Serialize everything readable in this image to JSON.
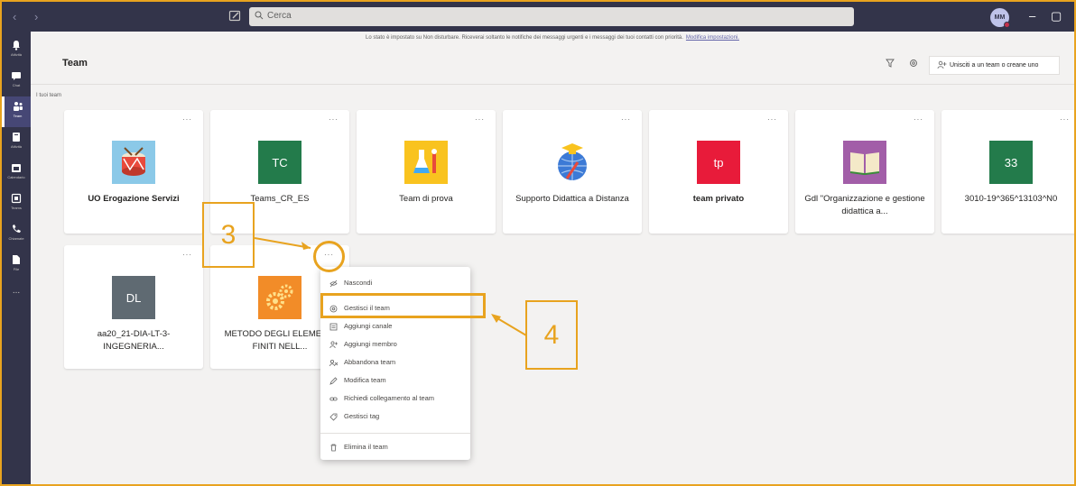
{
  "titlebar": {
    "search_placeholder": "Cerca",
    "avatar_initials": "MM",
    "minimize": "–",
    "restore": "▢"
  },
  "rail": [
    {
      "label": "Attività",
      "icon": "bell-icon"
    },
    {
      "label": "Chat",
      "icon": "chat-icon"
    },
    {
      "label": "Team",
      "icon": "teams-icon",
      "active": true
    },
    {
      "label": "Attività",
      "icon": "assignments-icon"
    },
    {
      "label": "Calendario",
      "icon": "calendar-icon"
    },
    {
      "label": "Teams",
      "icon": "files-icon"
    },
    {
      "label": "Chiamate",
      "icon": "phone-icon"
    },
    {
      "label": "File",
      "icon": "file-icon"
    },
    {
      "label": "...",
      "icon": "more-icon"
    }
  ],
  "banner": {
    "text": "Lo stato è impostato su Non disturbare. Riceverai soltanto le notifiche dei messaggi urgenti e i messaggi dei tuoi contatti con priorità.",
    "link": "Modifica impostazioni."
  },
  "header": {
    "title": "Team",
    "join_button": "Unisciti a un team o creane uno"
  },
  "section_label": "I tuoi team",
  "teams": [
    {
      "name": "UO Erogazione Servizi",
      "bold": true,
      "tile": "drum",
      "color": "#8bc9e8"
    },
    {
      "name": "Teams_CR_ES",
      "bold": false,
      "tile_text": "TC",
      "color": "#237b4b"
    },
    {
      "name": "Team di prova",
      "bold": false,
      "tile": "lab",
      "color": "#f9c31f"
    },
    {
      "name": "Supporto Didattica a Distanza",
      "bold": false,
      "tile": "globe",
      "color": "#3c7ad6"
    },
    {
      "name": "team privato",
      "bold": true,
      "tile_text": "tp",
      "color": "#e81b3a"
    },
    {
      "name": "Gdl \"Organizzazione e gestione didattica a...",
      "bold": false,
      "tile": "book",
      "color": "#a25ea8"
    },
    {
      "name": "3010-19^365^13103^N0",
      "bold": false,
      "tile_text": "33",
      "color": "#237b4b"
    },
    {
      "name": "aa20_21-DIA-LT-3-INGEGNERIA...",
      "bold": false,
      "tile_text": "DL",
      "color": "#5f6a72"
    },
    {
      "name": "METODO DEGLI ELEMENTI FINITI NELL...",
      "bold": false,
      "tile": "gears",
      "color": "#f28c28"
    }
  ],
  "menu": [
    {
      "label": "Nascondi",
      "icon": "hide-icon"
    },
    {
      "label": "Gestisci il team",
      "icon": "gear-icon"
    },
    {
      "label": "Aggiungi canale",
      "icon": "channel-icon"
    },
    {
      "label": "Aggiungi membro",
      "icon": "add-member-icon"
    },
    {
      "label": "Abbandona team",
      "icon": "leave-icon"
    },
    {
      "label": "Modifica team",
      "icon": "pencil-icon"
    },
    {
      "label": "Richiedi collegamento al team",
      "icon": "link-icon"
    },
    {
      "label": "Gestisci tag",
      "icon": "tag-icon"
    },
    {
      "label": "Elimina il team",
      "icon": "trash-icon"
    }
  ],
  "annotations": {
    "step3": "3",
    "step4": "4"
  },
  "colors": {
    "accent": "#e8a31f",
    "brand": "#6264a7",
    "titlebar": "#33344a"
  }
}
